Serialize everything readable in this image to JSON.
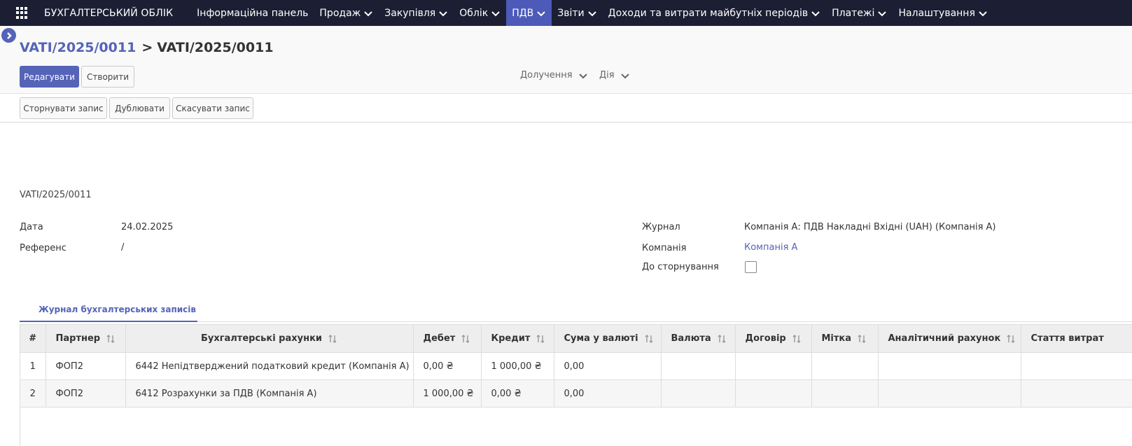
{
  "navbar": {
    "brand": "БУХГАЛТЕРСЬКИЙ ОБЛІК",
    "menu": [
      {
        "label": "Інформаційна панель",
        "has_caret": false
      },
      {
        "label": "Продаж",
        "has_caret": true
      },
      {
        "label": "Закупівля",
        "has_caret": true
      },
      {
        "label": "Облік",
        "has_caret": true
      },
      {
        "label": "ПДВ",
        "has_caret": true,
        "active": true
      },
      {
        "label": "Звіти",
        "has_caret": true
      },
      {
        "label": "Доходи та витрати майбутніх періодів",
        "has_caret": true
      },
      {
        "label": "Платежі",
        "has_caret": true
      },
      {
        "label": "Налаштування",
        "has_caret": true
      }
    ]
  },
  "breadcrumb": {
    "parent": "VATI/2025/0011",
    "separator": ">",
    "current": "VATI/2025/0011"
  },
  "buttons": {
    "edit": "Редагувати",
    "create": "Створити",
    "attach": "Долучення",
    "action": "Дія",
    "reverse": "Сторнувати запис",
    "duplicate": "Дублювати",
    "cancel_entry": "Скасувати запис"
  },
  "form": {
    "ref_title": "VATI/2025/0011",
    "date_label": "Дата",
    "date_value": "24.02.2025",
    "reference_label": "Референс",
    "reference_value": "/",
    "journal_label": "Журнал",
    "journal_value": "Компанія А: ПДВ Накладні Вхідні (UAH) (Компанія А)",
    "company_label": "Компанія",
    "company_value": "Компанія А",
    "to_reverse_label": "До сторнування",
    "to_reverse_checked": false
  },
  "tabs": {
    "journal_items": "Журнал бухгалтерських записів"
  },
  "table": {
    "headers": [
      "#",
      "Партнер",
      "Бухгалтерські рахунки",
      "Дебет",
      "Кредит",
      "Сума у валюті",
      "Валюта",
      "Договір",
      "Мітка",
      "Аналітичний рахунок",
      "Стаття витрат"
    ],
    "rows": [
      [
        "1",
        "ФОП2",
        "6442 Непідтверджений податковий кредит (Компанія А)",
        "0,00 ₴",
        "1 000,00 ₴",
        "0,00",
        "",
        "",
        "",
        "",
        ""
      ],
      [
        "2",
        "ФОП2",
        "6412 Розрахунки за ПДВ (Компанія А)",
        "1 000,00 ₴",
        "0,00 ₴",
        "0,00",
        "",
        "",
        "",
        "",
        ""
      ]
    ]
  },
  "colors": {
    "navbar_bg": "#1c1f33",
    "accent": "#5563b8",
    "active_menu_bg": "#4d5ab8"
  }
}
